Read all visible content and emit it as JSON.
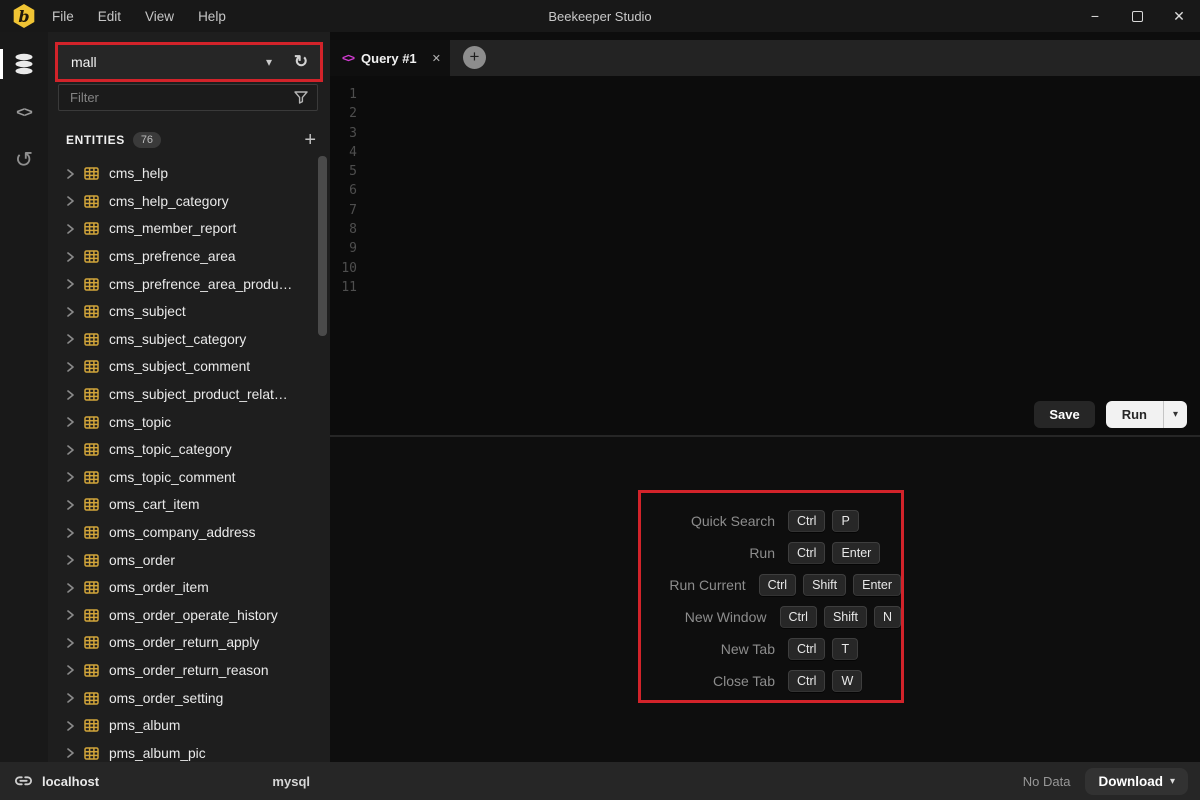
{
  "window": {
    "app_title": "Beekeeper Studio",
    "menu": [
      "File",
      "Edit",
      "View",
      "Help"
    ]
  },
  "icons": {
    "caret_down": "▾",
    "close": "✕",
    "plus": "+",
    "minimize": "−",
    "refresh": "↻",
    "history": "↺",
    "code": "<>"
  },
  "sidebar": {
    "database_dropdown": {
      "value": "mall"
    },
    "filter": {
      "placeholder": "Filter"
    },
    "entities": {
      "label": "ENTITIES",
      "count": "76"
    },
    "tables": [
      "cms_help",
      "cms_help_category",
      "cms_member_report",
      "cms_prefrence_area",
      "cms_prefrence_area_produ…",
      "cms_subject",
      "cms_subject_category",
      "cms_subject_comment",
      "cms_subject_product_relat…",
      "cms_topic",
      "cms_topic_category",
      "cms_topic_comment",
      "oms_cart_item",
      "oms_company_address",
      "oms_order",
      "oms_order_item",
      "oms_order_operate_history",
      "oms_order_return_apply",
      "oms_order_return_reason",
      "oms_order_setting",
      "pms_album",
      "pms_album_pic"
    ]
  },
  "editor": {
    "tab_label": "Query #1",
    "line_numbers": [
      "1",
      "2",
      "3",
      "4",
      "5",
      "6",
      "7",
      "8",
      "9",
      "10",
      "11"
    ],
    "save_label": "Save",
    "run_label": "Run"
  },
  "shortcuts": {
    "rows": [
      {
        "label": "Quick Search",
        "keys": [
          "Ctrl",
          "P"
        ]
      },
      {
        "label": "Run",
        "keys": [
          "Ctrl",
          "Enter"
        ]
      },
      {
        "label": "Run Current",
        "keys": [
          "Ctrl",
          "Shift",
          "Enter"
        ]
      },
      {
        "label": "New Window",
        "keys": [
          "Ctrl",
          "Shift",
          "N"
        ]
      },
      {
        "label": "New Tab",
        "keys": [
          "Ctrl",
          "T"
        ]
      },
      {
        "label": "Close Tab",
        "keys": [
          "Ctrl",
          "W"
        ]
      }
    ]
  },
  "statusbar": {
    "connection": "localhost",
    "db_type": "mysql",
    "result_status": "No Data",
    "download_label": "Download"
  },
  "colors": {
    "brand_yellow": "#f0c434",
    "table_icon_gold": "#d2a53a",
    "annotation_red": "#d2232a",
    "tab_icon_magenta": "#d33bd3"
  }
}
